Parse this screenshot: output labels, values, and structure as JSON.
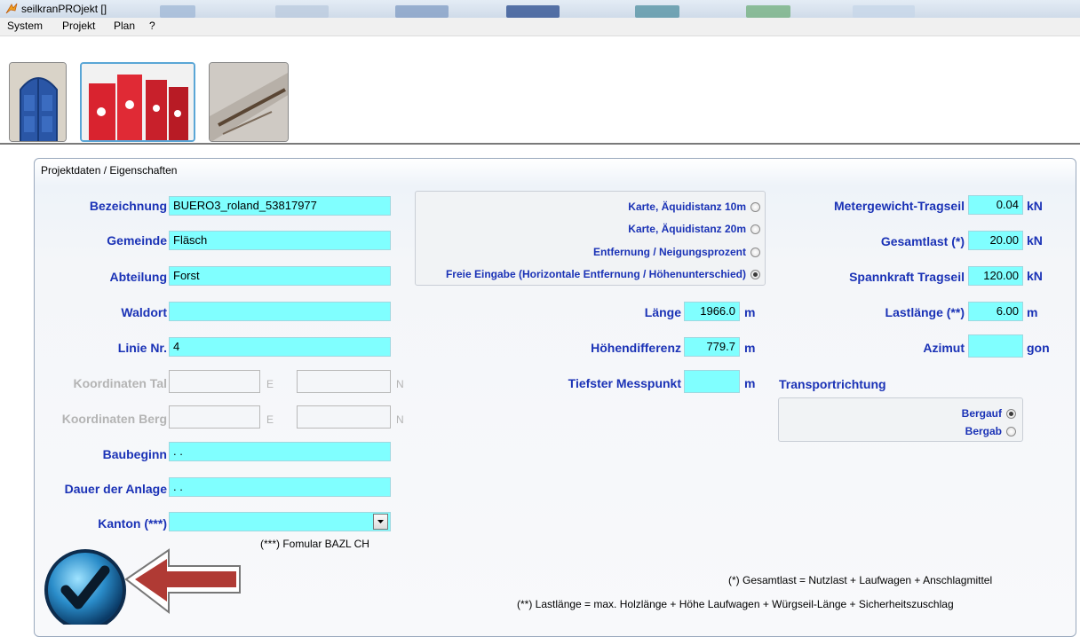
{
  "window": {
    "title": "seilkranPROjekt []"
  },
  "menu": [
    "System",
    "Projekt",
    "Plan",
    "?"
  ],
  "panel": {
    "title": "Projektdaten / Eigenschaften"
  },
  "left": {
    "bezeichnung": {
      "label": "Bezeichnung",
      "value": "BUERO3_roland_53817977"
    },
    "gemeinde": {
      "label": "Gemeinde",
      "value": "Fläsch"
    },
    "abteilung": {
      "label": "Abteilung",
      "value": "Forst"
    },
    "waldort": {
      "label": "Waldort",
      "value": ""
    },
    "linie": {
      "label": "Linie Nr.",
      "value": "4"
    },
    "koord_tal": {
      "label": "Koordinaten Tal",
      "e": "E",
      "n": "N"
    },
    "koord_berg": {
      "label": "Koordinaten Berg",
      "e": "E",
      "n": "N"
    },
    "baubeginn": {
      "label": "Baubeginn",
      "value": " .  ."
    },
    "dauer": {
      "label": "Dauer der Anlage",
      "value": " .  ."
    },
    "kanton": {
      "label": "Kanton (***)",
      "value": ""
    },
    "kanton_note": "(***) Fomular BAZL CH"
  },
  "middle": {
    "modes": [
      {
        "label": "Karte, Äquidistanz 10m",
        "selected": false
      },
      {
        "label": "Karte, Äquidistanz 20m",
        "selected": false
      },
      {
        "label": "Entfernung / Neigungsprozent",
        "selected": false
      },
      {
        "label": "Freie Eingabe (Horizontale Entfernung / Höhenunterschied)",
        "selected": true
      }
    ],
    "laenge": {
      "label": "Länge",
      "value": "1966.0",
      "unit": "m"
    },
    "hoehendifferenz": {
      "label": "Höhendifferenz",
      "value": "779.7",
      "unit": "m"
    },
    "messpunkt": {
      "label": "Tiefster Messpunkt",
      "value": "",
      "unit": "m"
    }
  },
  "right": {
    "metergewicht": {
      "label": "Metergewicht-Tragseil",
      "value": "0.04",
      "unit": "kN"
    },
    "gesamtlast": {
      "label": "Gesamtlast (*)",
      "value": "20.00",
      "unit": "kN"
    },
    "spannkraft": {
      "label": "Spannkraft Tragseil",
      "value": "120.00",
      "unit": "kN"
    },
    "lastlaenge": {
      "label": "Lastlänge (**)",
      "value": "6.00",
      "unit": "m"
    },
    "azimut": {
      "label": "Azimut",
      "value": "",
      "unit": "gon"
    },
    "transport": {
      "label": "Transportrichtung",
      "options": [
        {
          "label": "Bergauf",
          "selected": true
        },
        {
          "label": "Bergab",
          "selected": false
        }
      ]
    }
  },
  "notes": {
    "gesamtlast": "(*) Gesamtlast = Nutzlast + Laufwagen + Anschlagmittel",
    "lastlaenge": "(**) Lastlänge = max. Holzlänge + Höhe Laufwagen + Würgseil-Länge + Sicherheitszuschlag"
  },
  "colors": {
    "label": "#1a32b6",
    "field": "#80ffff",
    "arrow": "#b03a34"
  }
}
